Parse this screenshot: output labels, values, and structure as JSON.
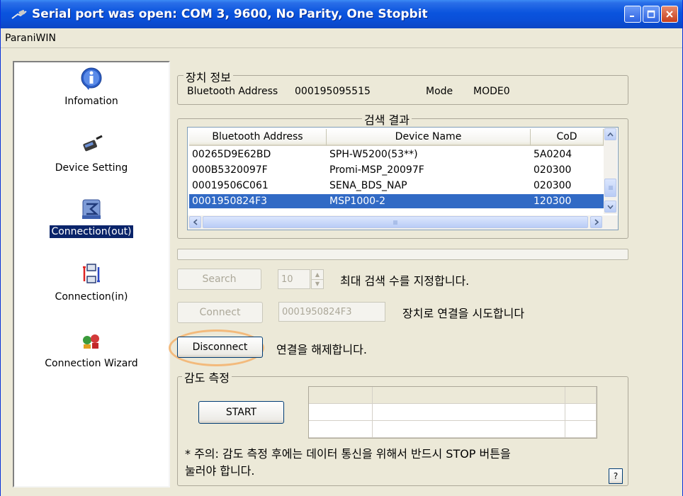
{
  "window": {
    "title": "Serial port was open: COM 3, 9600, No Parity, One Stopbit"
  },
  "menu": {
    "item": "ParaniWIN"
  },
  "sidebar": {
    "items": [
      {
        "label": "Infomation"
      },
      {
        "label": "Device Setting"
      },
      {
        "label": "Connection(out)"
      },
      {
        "label": "Connection(in)"
      },
      {
        "label": "Connection Wizard"
      }
    ]
  },
  "device_info": {
    "legend": "장치 정보",
    "address_label": "Bluetooth Address",
    "address_value": "000195095515",
    "mode_label": "Mode",
    "mode_value": "MODE0"
  },
  "results": {
    "legend": "검색 결과",
    "columns": [
      "Bluetooth Address",
      "Device Name",
      "CoD"
    ],
    "rows": [
      [
        "00265D9E62BD",
        "SPH-W5200(53**)",
        "5A0204"
      ],
      [
        "000B5320097F",
        "Promi-MSP_20097F",
        "020300"
      ],
      [
        "00019506C061",
        "SENA_BDS_NAP",
        "020300"
      ],
      [
        "0001950824F3",
        "MSP1000-2",
        "120300"
      ]
    ]
  },
  "controls": {
    "search_label": "Search",
    "search_count": "10",
    "search_desc": "최대 검색 수를 지정합니다.",
    "connect_label": "Connect",
    "connect_address": "0001950824F3",
    "connect_desc": "장치로 연결을 시도합니다",
    "disconnect_label": "Disconnect",
    "disconnect_desc": "연결을 해제합니다."
  },
  "sensitivity": {
    "legend": "감도 측정",
    "start_label": "START",
    "note_line1": "* 주의: 감도 측정 후에는 데이터 통신을 위해서 반드시 STOP 버튼을",
    "note_line2": "눌러야 합니다.",
    "help_label": "?"
  },
  "colors": {
    "titlebar": "#0a54de",
    "selection": "#316ac5",
    "highlight_ring": "#f3ba7c"
  }
}
